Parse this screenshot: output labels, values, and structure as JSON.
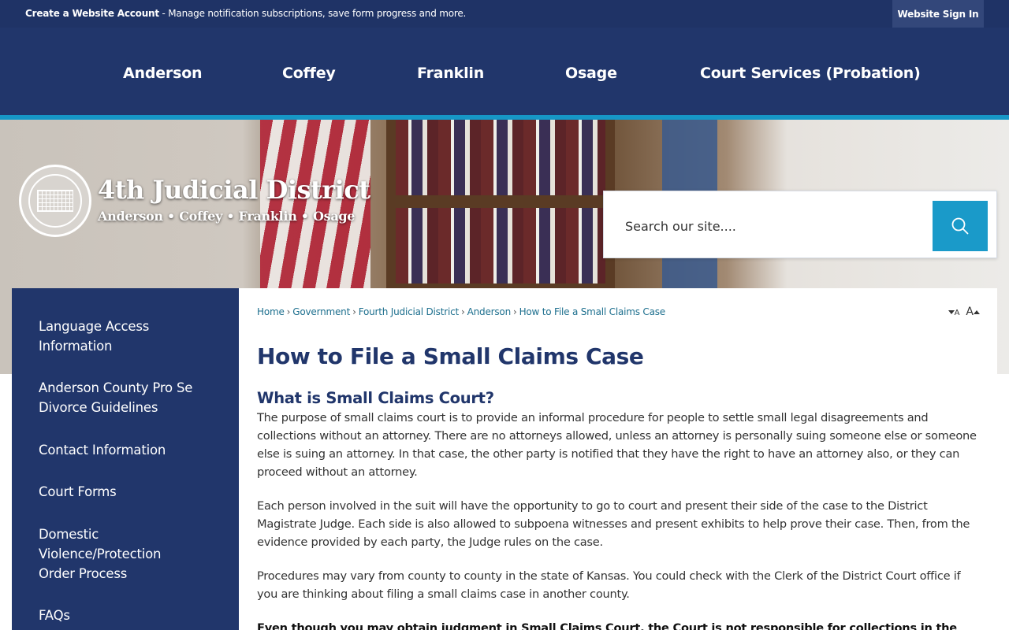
{
  "topbar": {
    "promo_bold": "Create a Website Account",
    "promo_text": " - Manage notification subscriptions, save form progress and more.",
    "signin_label": "Website Sign In"
  },
  "nav": {
    "items": [
      {
        "label": "Anderson"
      },
      {
        "label": "Coffey"
      },
      {
        "label": "Franklin"
      },
      {
        "label": "Osage"
      },
      {
        "label": "Court Services (Probation)"
      }
    ]
  },
  "hero": {
    "title": "4th Judicial District",
    "subtitle": "Anderson • Coffey • Franklin • Osage",
    "seal_icon": "district-court-seal"
  },
  "search": {
    "placeholder": "Search our site....",
    "button_icon": "search-icon"
  },
  "sidebar": {
    "items": [
      {
        "label": "Language Access Information"
      },
      {
        "label": "Anderson County Pro Se Divorce Guidelines"
      },
      {
        "label": "Contact Information"
      },
      {
        "label": "Court Forms"
      },
      {
        "label": "Domestic Violence/Protection Order Process"
      },
      {
        "label": "FAQs"
      }
    ]
  },
  "breadcrumb": {
    "items": [
      {
        "label": "Home"
      },
      {
        "label": "Government"
      },
      {
        "label": "Fourth Judicial District"
      },
      {
        "label": "Anderson"
      },
      {
        "label": "How to File a Small Claims Case"
      }
    ],
    "separator": "›"
  },
  "font_controls": {
    "decrease_label": "A",
    "increase_label": "A"
  },
  "article": {
    "title": "How to File a Small Claims Case",
    "section_title": "What is Small Claims Court?",
    "paragraphs": [
      "The purpose of small claims court is to provide an informal procedure for people to settle small legal disagreements and collections without an attorney. There are no attorneys allowed, unless an attorney is personally suing someone else or someone else is suing an attorney. In that case, the other party is notified that they have the right to have an attorney also, or they can proceed without an attorney.",
      "Each person involved in the suit will have the opportunity to go to court and present their side of the case to the District Magistrate Judge. Each side is also allowed to subpoena witnesses and present exhibits to help prove their case. Then, from the evidence provided by each party, the Judge rules on the case.",
      "Procedures may vary from county to county in the state of Kansas. You could check with the Clerk of the District Court office if you are thinking about filing a small claims case in another county.",
      "Even though you may obtain judgment in Small Claims Court, the Court is not responsible for collections in the"
    ]
  },
  "colors": {
    "navy": "#21366b",
    "topbar": "#1f3366",
    "accent": "#1697c6",
    "search_button": "#1a9ac9",
    "link": "#1d6f8e"
  }
}
